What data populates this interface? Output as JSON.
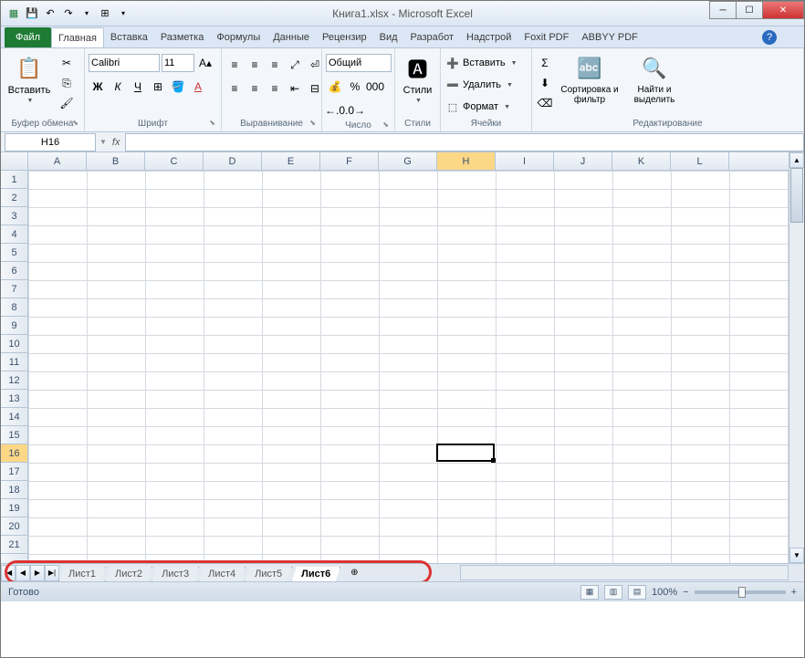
{
  "title": "Книга1.xlsx - Microsoft Excel",
  "qat": {
    "save": "💾",
    "undo": "↶",
    "redo": "↷"
  },
  "tabs": {
    "file": "Файл",
    "items": [
      "Главная",
      "Вставка",
      "Разметка",
      "Формулы",
      "Данные",
      "Рецензир",
      "Вид",
      "Разработ",
      "Надстрой",
      "Foxit PDF",
      "ABBYY PDF"
    ],
    "active": 0
  },
  "ribbon": {
    "clipboard": {
      "label": "Буфер обмена",
      "paste": "Вставить"
    },
    "font": {
      "label": "Шрифт",
      "name": "Calibri",
      "size": "11"
    },
    "alignment": {
      "label": "Выравнивание"
    },
    "number": {
      "label": "Число",
      "format": "Общий"
    },
    "styles": {
      "label": "Стили",
      "btn": "Стили"
    },
    "cells": {
      "label": "Ячейки",
      "insert": "Вставить",
      "delete": "Удалить",
      "format": "Формат"
    },
    "editing": {
      "label": "Редактирование",
      "sort": "Сортировка и фильтр",
      "find": "Найти и выделить"
    }
  },
  "namebox": "H16",
  "columns": [
    "A",
    "B",
    "C",
    "D",
    "E",
    "F",
    "G",
    "H",
    "I",
    "J",
    "K",
    "L"
  ],
  "rows_visible": 21,
  "active_col": "H",
  "active_row": 16,
  "sheets": [
    "Лист1",
    "Лист2",
    "Лист3",
    "Лист4",
    "Лист5",
    "Лист6"
  ],
  "active_sheet": 5,
  "status": {
    "ready": "Готово",
    "zoom": "100%"
  }
}
